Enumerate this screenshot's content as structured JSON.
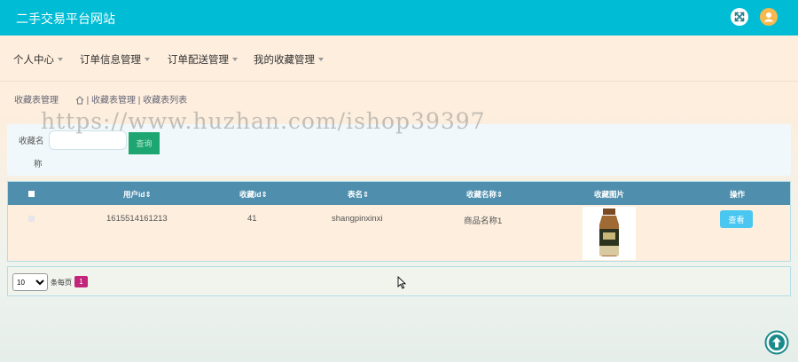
{
  "app": {
    "title": "二手交易平台网站"
  },
  "nav": {
    "items": [
      {
        "label": "个人中心"
      },
      {
        "label": "订单信息管理"
      },
      {
        "label": "订单配送管理"
      },
      {
        "label": "我的收藏管理"
      }
    ]
  },
  "breadcrumb": {
    "root": "收藏表管理",
    "path": "| 收藏表管理 | 收藏表列表"
  },
  "watermark": "https://www.huzhan.com/ishop39397",
  "search": {
    "label_line1": "收藏名",
    "label_line2": "称",
    "value": "",
    "placeholder": "",
    "button_label": "查询"
  },
  "table": {
    "columns": [
      "用户id",
      "收藏id",
      "表名",
      "收藏名称",
      "收藏图片",
      "操作"
    ],
    "rows": [
      {
        "user_id": "1615514161213",
        "fav_id": "41",
        "table_name": "shangpinxinxi",
        "fav_name": "商品名称1",
        "action_label": "查看"
      }
    ]
  },
  "pagination": {
    "page_size": "10",
    "page_size_options": [
      "10"
    ],
    "per_page_label": "条每页",
    "current_page": "1"
  },
  "colors": {
    "header_bg": "#00bcd4",
    "table_header_bg": "#4f8fad",
    "search_button": "#1ea672",
    "view_button": "#49c7f0",
    "page_active": "#c2257a",
    "accent_orange": "#f7b94d"
  },
  "icons": {
    "fullscreen": "expand-icon",
    "user": "user-avatar-icon",
    "home": "home-icon",
    "scroll_top": "arrow-up-circle-icon",
    "cursor": "mouse-pointer-icon"
  }
}
